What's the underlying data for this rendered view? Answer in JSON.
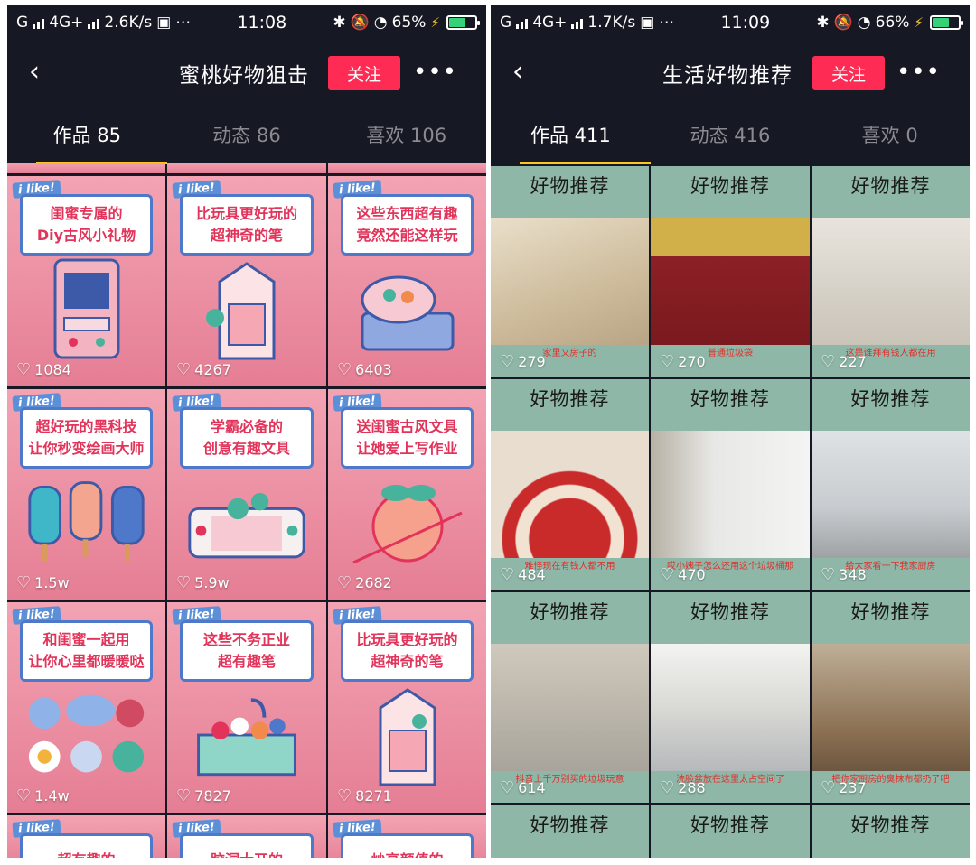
{
  "left": {
    "status": {
      "network": "4G+",
      "speed": "2.6K/s",
      "time": "11:08",
      "battery": "65%",
      "battery_fraction": 0.65
    },
    "header": {
      "title": "蜜桃好物狙击",
      "follow": "关注"
    },
    "tabs": [
      {
        "label": "作品 85"
      },
      {
        "label": "动态 86"
      },
      {
        "label": "喜欢 106"
      }
    ],
    "posts": [
      {
        "badge": "i like!",
        "line1": "闺蜜专属的",
        "line2": "Diy古风小礼物",
        "likes": "1084"
      },
      {
        "badge": "i like!",
        "line1": "比玩具更好玩的",
        "line2": "超神奇的笔",
        "likes": "4267"
      },
      {
        "badge": "i like!",
        "line1": "这些东西超有趣",
        "line2": "竟然还能这样玩",
        "likes": "6403"
      },
      {
        "badge": "i like!",
        "line1": "超好玩的黑科技",
        "line2": "让你秒变绘画大师",
        "likes": "1.5w"
      },
      {
        "badge": "i like!",
        "line1": "学霸必备的",
        "line2": "创意有趣文具",
        "likes": "5.9w"
      },
      {
        "badge": "i like!",
        "line1": "送闺蜜古风文具",
        "line2": "让她爱上写作业",
        "likes": "2682"
      },
      {
        "badge": "i like!",
        "line1": "和闺蜜一起用",
        "line2": "让你心里都暖暖哒",
        "likes": "1.4w"
      },
      {
        "badge": "i like!",
        "line1": "这些不务正业",
        "line2": "超有趣笔",
        "likes": "7827"
      },
      {
        "badge": "i like!",
        "line1": "比玩具更好玩的",
        "line2": "超神奇的笔",
        "likes": "8271"
      },
      {
        "badge": "i like!",
        "line1": "超有趣的",
        "line2": "",
        "likes": ""
      },
      {
        "badge": "i like!",
        "line1": "脑洞大开的",
        "line2": "",
        "likes": ""
      },
      {
        "badge": "i like!",
        "line1": "炒高颜值的",
        "line2": "",
        "likes": ""
      }
    ]
  },
  "right": {
    "status": {
      "network": "4G+",
      "speed": "1.7K/s",
      "time": "11:09",
      "battery": "66%",
      "battery_fraction": 0.66
    },
    "header": {
      "title": "生活好物推荐",
      "follow": "关注"
    },
    "tabs": [
      {
        "label": "作品 411"
      },
      {
        "label": "动态 416"
      },
      {
        "label": "喜欢 0"
      }
    ],
    "posts": [
      {
        "title": "好物推荐",
        "caption": "家里又房子的",
        "likes": "279"
      },
      {
        "title": "好物推荐",
        "caption": "普通垃圾袋",
        "likes": "270"
      },
      {
        "title": "好物推荐",
        "caption": "这是谁拜有钱人都在用",
        "likes": "227"
      },
      {
        "title": "好物推荐",
        "caption": "难怪现在有钱人都不用",
        "likes": "484"
      },
      {
        "title": "好物推荐",
        "caption": "哎小姨子怎么还用这个垃圾桶那",
        "likes": "470"
      },
      {
        "title": "好物推荐",
        "caption": "给大家看一下我家厨房",
        "likes": "348"
      },
      {
        "title": "好物推荐",
        "caption": "抖音上千万别买的垃圾玩意",
        "likes": "614"
      },
      {
        "title": "好物推荐",
        "caption": "洗脸盆放在这里太占空间了",
        "likes": "288"
      },
      {
        "title": "好物推荐",
        "caption": "把你家厨房的臭抹布都扔了吧",
        "likes": "237"
      },
      {
        "title": "好物推荐",
        "caption": "",
        "likes": ""
      },
      {
        "title": "好物推荐",
        "caption": "",
        "likes": ""
      },
      {
        "title": "好物推荐",
        "caption": "",
        "likes": ""
      }
    ]
  },
  "colors": {
    "follow": "#fe2c55",
    "tab_indicator": "#fcc521",
    "background": "#161823"
  }
}
